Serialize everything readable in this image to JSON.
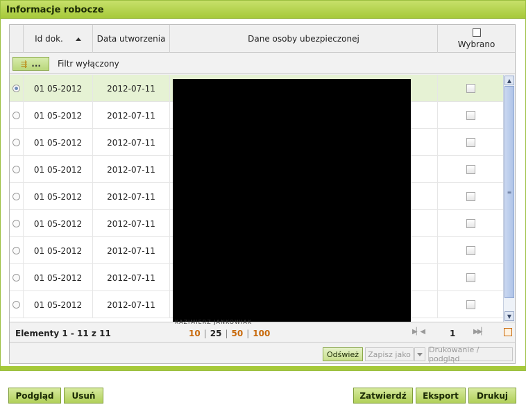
{
  "panel": {
    "title": "Informacje robocze"
  },
  "columns": {
    "id": "Id dok.",
    "date": "Data utworzenia",
    "person": "Dane osoby ubezpieczonej",
    "selected": "Wybrano"
  },
  "filter": {
    "button_label": "...",
    "label": "Filtr wyłączony"
  },
  "rows": [
    {
      "id": "01 05-2012",
      "date": "2012-07-11",
      "radio_selected": true
    },
    {
      "id": "01 05-2012",
      "date": "2012-07-11",
      "radio_selected": false
    },
    {
      "id": "01 05-2012",
      "date": "2012-07-11",
      "radio_selected": false
    },
    {
      "id": "01 05-2012",
      "date": "2012-07-11",
      "radio_selected": false
    },
    {
      "id": "01 05-2012",
      "date": "2012-07-11",
      "radio_selected": false
    },
    {
      "id": "01 05-2012",
      "date": "2012-07-11",
      "radio_selected": false
    },
    {
      "id": "01 05-2012",
      "date": "2012-07-11",
      "radio_selected": false
    },
    {
      "id": "01 05-2012",
      "date": "2012-07-11",
      "radio_selected": false
    },
    {
      "id": "01 05-2012",
      "date": "2012-07-11",
      "radio_selected": false
    }
  ],
  "cut_off_text": "KAZIMIERZ JANKOWIAK",
  "pager": {
    "count_label": "Elementy 1 - 11 z 11",
    "sizes": [
      "10",
      "25",
      "50",
      "100"
    ],
    "current_size": "25",
    "page": "1"
  },
  "actions": {
    "refresh": "Odśwież",
    "save_as": "Zapisz jako",
    "print_preview": "Drukowanie / podgląd"
  },
  "bottom_buttons": {
    "preview": "Podgląd",
    "delete": "Usuń",
    "confirm": "Zatwierdź",
    "export": "Eksport",
    "print": "Drukuj"
  },
  "colors": {
    "accent": "#a6c93a",
    "selected_row": "#e6f2d4",
    "page_size_link": "#c86a0c"
  },
  "icons": {
    "filter": "filter-icon",
    "sort": "sort-ascending-icon",
    "first_page": "first-page-icon",
    "last_page": "last-page-icon",
    "export_end": "end-marker-icon"
  }
}
